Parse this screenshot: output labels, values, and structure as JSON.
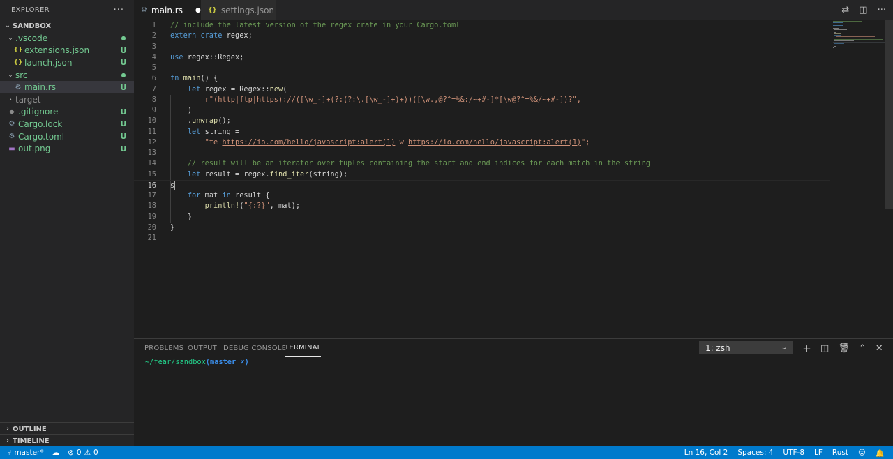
{
  "explorer": {
    "title": "EXPLORER",
    "more": "···",
    "root": "SANDBOX",
    "items": [
      {
        "label": ".vscode",
        "indicator": "●"
      },
      {
        "label": "extensions.json",
        "badge": "U"
      },
      {
        "label": "launch.json",
        "badge": "U"
      },
      {
        "label": "src",
        "indicator": "●"
      },
      {
        "label": "main.rs",
        "badge": "U"
      },
      {
        "label": "target",
        "badge": ""
      },
      {
        "label": ".gitignore",
        "badge": "U"
      },
      {
        "label": "Cargo.lock",
        "badge": "U"
      },
      {
        "label": "Cargo.toml",
        "badge": "U"
      },
      {
        "label": "out.png",
        "badge": "U"
      }
    ],
    "outline": "OUTLINE",
    "timeline": "TIMELINE"
  },
  "tabs": [
    {
      "label": "main.rs",
      "modified": "●"
    },
    {
      "label": "settings.json"
    }
  ],
  "editor": {
    "line_numbers": [
      "1",
      "2",
      "3",
      "4",
      "5",
      "6",
      "7",
      "8",
      "9",
      "10",
      "11",
      "12",
      "13",
      "14",
      "15",
      "16",
      "17",
      "18",
      "19",
      "20",
      "21"
    ],
    "l1": "// include the latest version of the regex crate in your Cargo.toml",
    "l2_kw": "extern crate",
    "l2_rest": " regex;",
    "l4_kw": "use",
    "l4_rest": " regex::Regex;",
    "l6_kw": "fn",
    "l6_fn": "main",
    "l6_rest": "() {",
    "l7_kw": "let",
    "l7_rest": " regex = Regex::",
    "l7_fn": "new",
    "l7_end": "(",
    "l8": "r\"(http|ftp|https)://([\\w_-]+(?:(?:\\.[\\w_-]+)+))([\\w.,@?^=%&:/~+#-]*[\\w@?^=%&/~+#-])?\",",
    "l9": ")",
    "l10_pre": ".",
    "l10_fn": "unwrap",
    "l10_rest": "();",
    "l11_kw": "let",
    "l11_rest": " string =",
    "l12_a": "\"te ",
    "l12_url1": "https://io.com/hello/javascript:alert(1)",
    "l12_b": " w ",
    "l12_url2": "https://io.com/hello/javascript:alert(1)",
    "l12_c": "\";",
    "l14": "// result will be an iterator over tuples containing the start and end indices for each match in the string",
    "l15_kw": "let",
    "l15_rest": " result = regex.",
    "l15_fn": "find_iter",
    "l15_end": "(string);",
    "l16": "s",
    "l17_kw1": "for",
    "l17_mid": " mat ",
    "l17_kw2": "in",
    "l17_rest": " result {",
    "l18_fn": "println!",
    "l18_a": "(",
    "l18_st": "\"{:?}\"",
    "l18_b": ", mat);",
    "l19": "}",
    "l20": "}"
  },
  "panel": {
    "tabs": [
      "PROBLEMS",
      "OUTPUT",
      "DEBUG CONSOLE",
      "TERMINAL"
    ],
    "terminal_select": "1: zsh",
    "prompt_path": "~/fear/sandbox",
    "prompt_branch": "(master ",
    "prompt_symbol": "✗)"
  },
  "status": {
    "branch": "master*",
    "errors": "0",
    "warnings": "0",
    "position": "Ln 16, Col 2",
    "spaces": "Spaces: 4",
    "encoding": "UTF-8",
    "eol": "LF",
    "language": "Rust"
  },
  "colors": {
    "statusbar": "#007acc",
    "sidebar": "#252526",
    "editor": "#1e1e1e",
    "git_untracked": "#73c991"
  }
}
